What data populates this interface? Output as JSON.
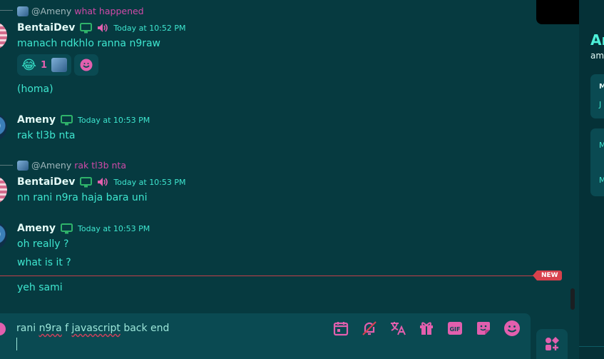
{
  "messages": [
    {
      "reply_at": "@Ameny",
      "reply_text": "what happened",
      "author": "BentaiDev",
      "time": "Today at 10:52 PM",
      "lines": [
        "manach ndkhlo ranna n9raw"
      ]
    },
    {
      "reactions": [
        {
          "emoji": "😂",
          "count": "1"
        }
      ],
      "continuation": "(homa)"
    },
    {
      "author": "Ameny",
      "time": "Today at 10:53 PM",
      "lines": [
        "rak tl3b nta"
      ]
    },
    {
      "reply_at": "@Ameny",
      "reply_text": "rak tl3b nta",
      "author": "BentaiDev",
      "time": "Today at 10:53 PM",
      "lines": [
        "nn rani n9ra haja bara uni"
      ]
    },
    {
      "author": "Ameny",
      "time": "Today at 10:53 PM",
      "lines": [
        "oh really ?",
        "what is it ?"
      ]
    },
    {
      "lines": [
        "yeh sami"
      ]
    }
  ],
  "new_badge": "NEW",
  "composer": {
    "draft": "rani n9ra f javascript back end",
    "draft_parts": [
      "rani ",
      "n9ra",
      " f ",
      "javascript",
      " back end"
    ]
  },
  "icons": {
    "calendar": "calendar-icon",
    "mute": "bell-off-icon",
    "translate": "translate-icon",
    "gift": "gift-icon",
    "gif": "gif-icon",
    "sticker": "sticker-icon",
    "emoji": "emoji-icon",
    "apps": "apps-icon"
  },
  "colors": {
    "accent": "#3ee6cf",
    "pink": "#e25fae",
    "background": "#063a40",
    "new_red": "#d8414c"
  },
  "panel": {
    "name": "Am",
    "handle": "am",
    "card1": [
      "M",
      "J"
    ],
    "card2": [
      "M",
      "M"
    ]
  }
}
